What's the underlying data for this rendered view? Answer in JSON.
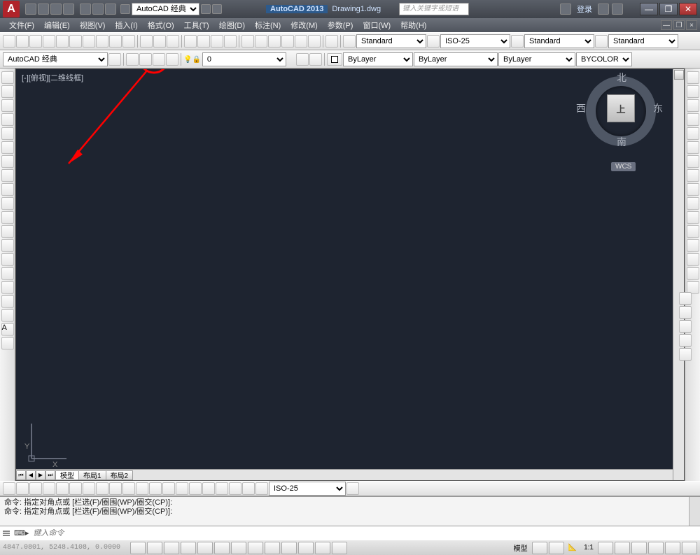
{
  "title": {
    "app": "AutoCAD 2013",
    "doc": "Drawing1.dwg",
    "search_placeholder": "键入关键字或短语",
    "login": "登录"
  },
  "workspace": "AutoCAD 经典",
  "menus": [
    "文件(F)",
    "编辑(E)",
    "视图(V)",
    "插入(I)",
    "格式(O)",
    "工具(T)",
    "绘图(D)",
    "标注(N)",
    "修改(M)",
    "参数(P)",
    "窗口(W)",
    "帮助(H)"
  ],
  "styles": {
    "text": "Standard",
    "dim": "ISO-25",
    "table": "Standard",
    "ml": "Standard"
  },
  "layer": {
    "current": "0",
    "color_control": "ByLayer",
    "ltype": "ByLayer",
    "lweight": "ByLayer",
    "plotstyle": "BYCOLOR"
  },
  "view": {
    "label": "[-][俯视][二维线框]",
    "cube_top": "上",
    "n": "北",
    "s": "南",
    "e": "东",
    "w": "西",
    "wcs": "WCS",
    "axis_x": "X",
    "axis_y": "Y"
  },
  "tabs": {
    "model": "模型",
    "layouts": [
      "布局1",
      "布局2"
    ]
  },
  "dim_combo": "ISO-25",
  "cmd_history": [
    "命令: 指定对角点或 [栏选(F)/圈围(WP)/圈交(CP)]:",
    "命令: 指定对角点或 [栏选(F)/圈围(WP)/圈交(CP)]:"
  ],
  "cmd_prompt": "⌨▸",
  "cmd_placeholder": "键入命令",
  "status": {
    "coords": "4847.0801, 5248.4108, 0.0000",
    "model": "模型",
    "scale": "1:1"
  }
}
